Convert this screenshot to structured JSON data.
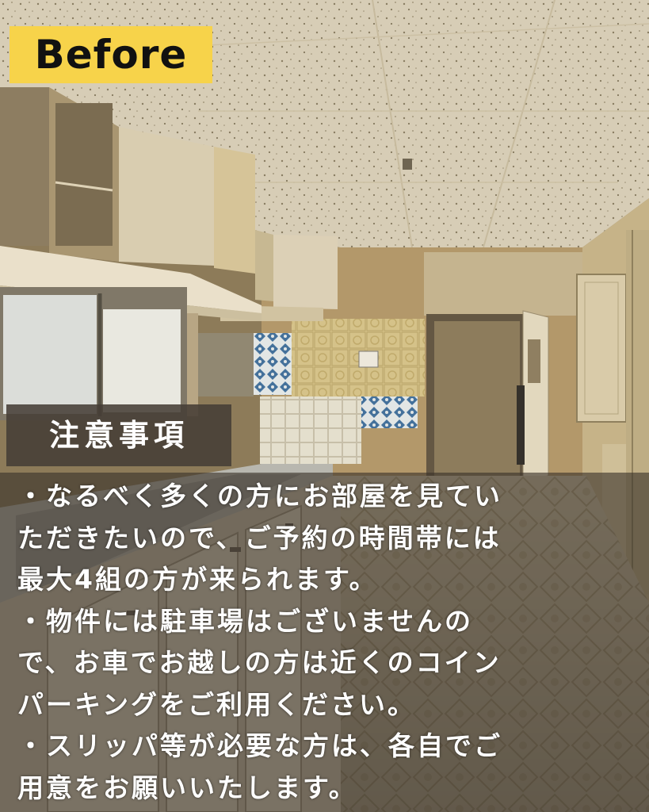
{
  "badge": {
    "label": "Before"
  },
  "notice": {
    "title": "注意事項",
    "lines": [
      "・なるべく多くの方にお部屋を見てい",
      "ただきたいので、ご予約の時間帯には",
      "最大4組の方が来られます。",
      "・物件には駐車場はございませんの",
      "で、お車でお越しの方は近くのコイン",
      "パーキングをご利用ください。",
      "・スリッパ等が必要な方は、各自でご",
      "用意をお願いいたします。"
    ]
  }
}
